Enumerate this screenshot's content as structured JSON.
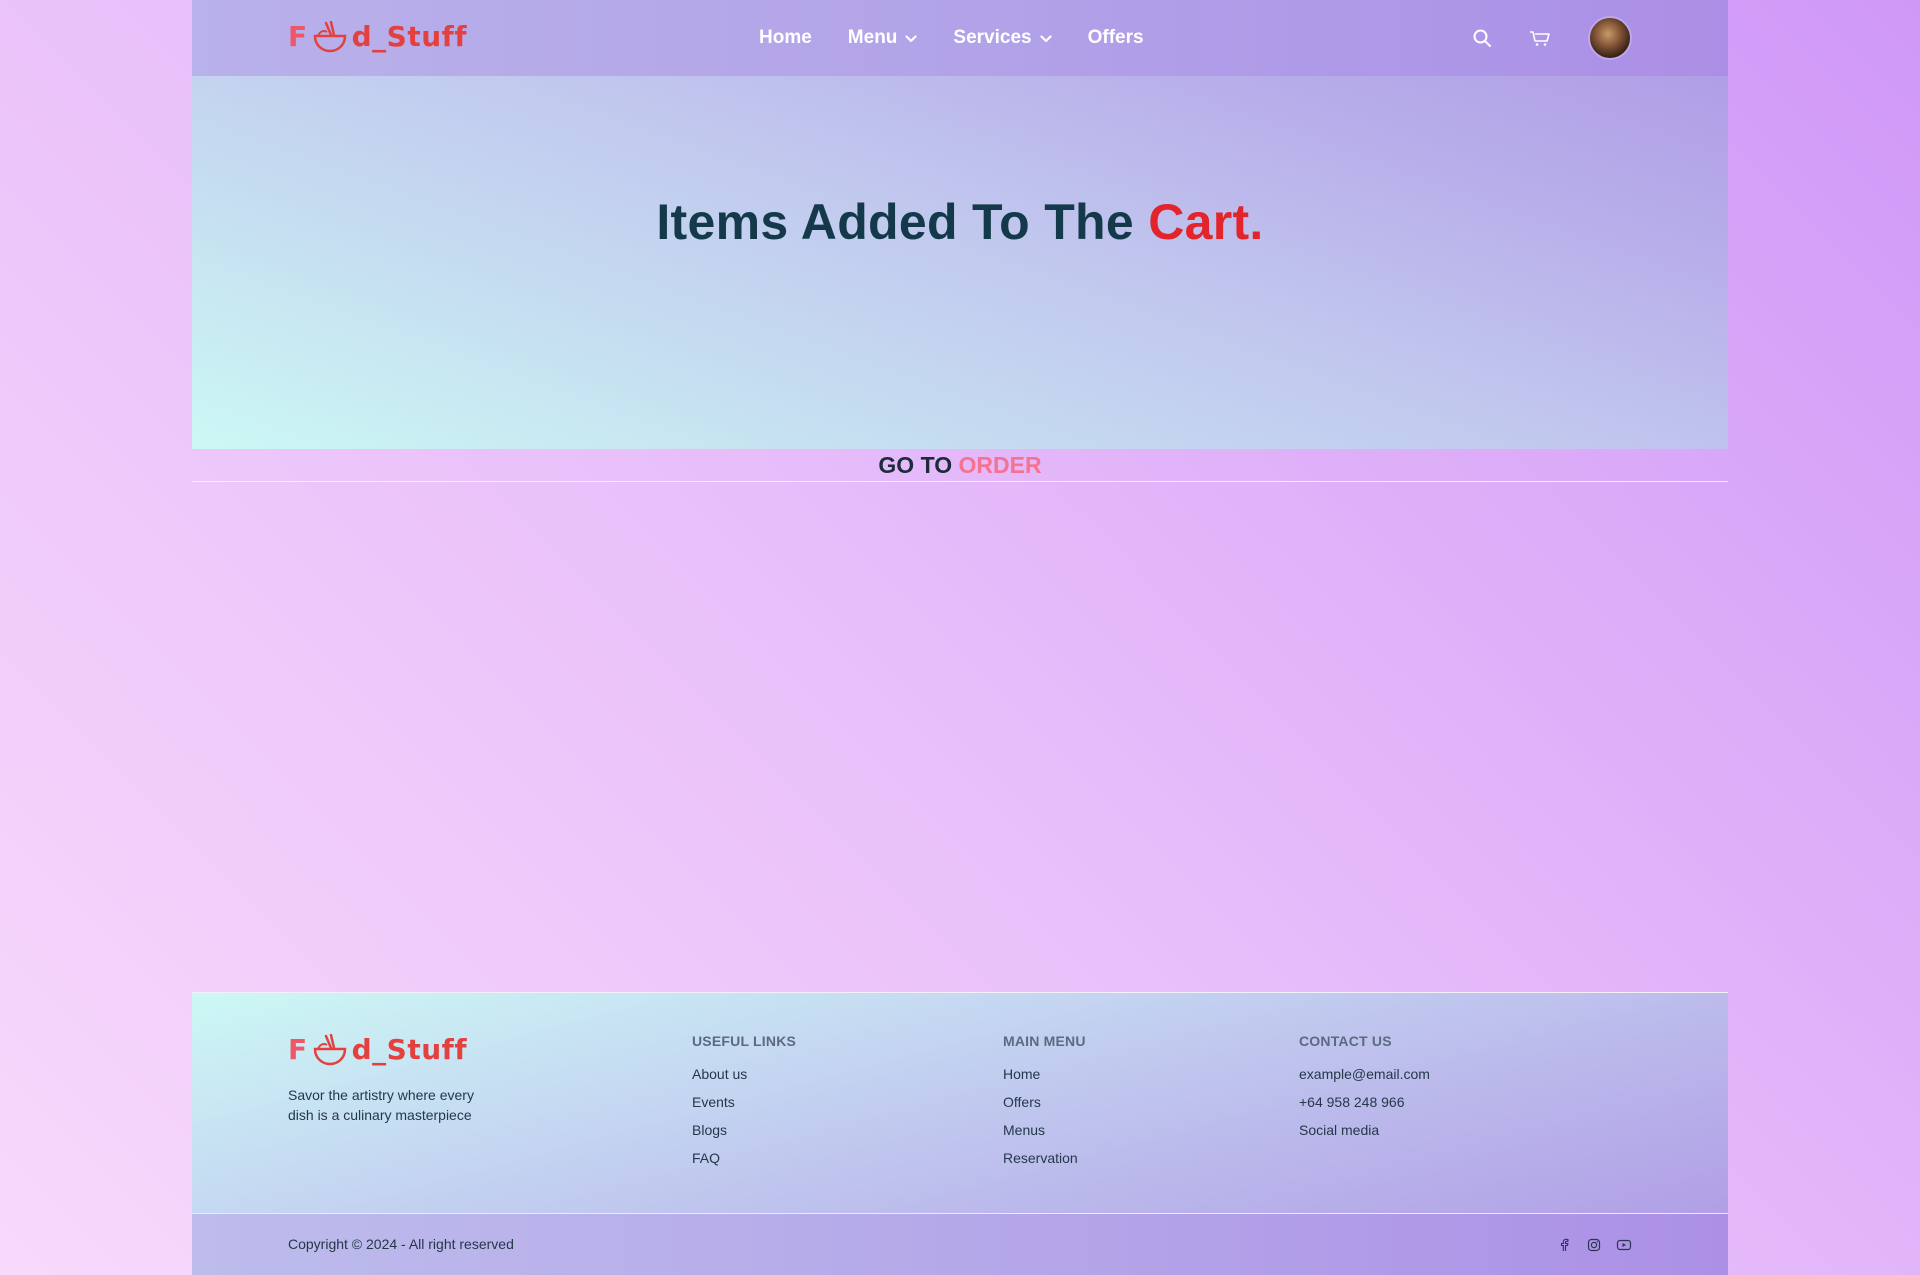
{
  "brand": {
    "logo_prefix": "F",
    "logo_suffix": "d_Stuff",
    "logo_color": "#e4403f"
  },
  "nav": {
    "items": [
      {
        "label": "Home",
        "has_dropdown": false
      },
      {
        "label": "Menu",
        "has_dropdown": true
      },
      {
        "label": "Services",
        "has_dropdown": true
      },
      {
        "label": "Offers",
        "has_dropdown": false
      }
    ]
  },
  "header_icons": [
    "search-icon",
    "cart-icon",
    "avatar"
  ],
  "hero": {
    "title_main": "Items Added To The ",
    "title_accent": "Cart.",
    "accent_color": "#e4242b"
  },
  "goto": {
    "prefix": "GO TO ",
    "accent": "ORDER",
    "accent_color": "#f57390"
  },
  "footer": {
    "tagline": "Savor the artistry where every dish is a culinary masterpiece",
    "columns": [
      {
        "heading": "USEFUL LINKS",
        "links": [
          "About us",
          "Events",
          "Blogs",
          "FAQ"
        ]
      },
      {
        "heading": "MAIN MENU",
        "links": [
          "Home",
          "Offers",
          "Menus",
          "Reservation"
        ]
      },
      {
        "heading": "CONTACT US",
        "links": [
          "example@email.com",
          "+64 958 248 966",
          "Social media"
        ]
      }
    ],
    "copyright": "Copyright © 2024 - All right reserved",
    "socials": [
      "facebook-icon",
      "instagram-icon",
      "youtube-icon"
    ]
  }
}
